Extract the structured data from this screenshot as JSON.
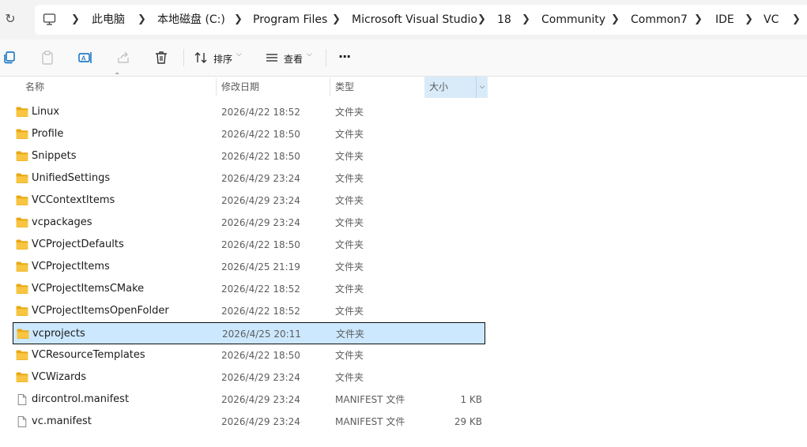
{
  "address_bar": {
    "refresh_icon": "refresh-icon",
    "root_icon": "computer-icon",
    "breadcrumbs": [
      "此电脑",
      "本地磁盘 (C:)",
      "Program Files",
      "Microsoft Visual Studio",
      "18",
      "Community",
      "Common7",
      "IDE",
      "VC"
    ]
  },
  "toolbar": {
    "sort_label": "排序",
    "view_label": "查看",
    "more_label": "···",
    "icons": [
      "copy-icon",
      "paste-icon",
      "rename-icon",
      "share-icon",
      "delete-icon",
      "sort-icon",
      "view-icon",
      "more-icon"
    ]
  },
  "columns": {
    "name": "名称",
    "modified": "修改日期",
    "type": "类型",
    "size": "大小"
  },
  "colors": {
    "folder": "#f8c542",
    "selection": "#cce8ff",
    "header_active": "#d9ebf9"
  },
  "files": [
    {
      "name": "Linux",
      "modified": "2026/4/22 18:52",
      "type": "文件夹",
      "size": "",
      "kind": "folder"
    },
    {
      "name": "Profile",
      "modified": "2026/4/22 18:50",
      "type": "文件夹",
      "size": "",
      "kind": "folder"
    },
    {
      "name": "Snippets",
      "modified": "2026/4/22 18:50",
      "type": "文件夹",
      "size": "",
      "kind": "folder"
    },
    {
      "name": "UnifiedSettings",
      "modified": "2026/4/29 23:24",
      "type": "文件夹",
      "size": "",
      "kind": "folder"
    },
    {
      "name": "VCContextItems",
      "modified": "2026/4/29 23:24",
      "type": "文件夹",
      "size": "",
      "kind": "folder"
    },
    {
      "name": "vcpackages",
      "modified": "2026/4/29 23:24",
      "type": "文件夹",
      "size": "",
      "kind": "folder"
    },
    {
      "name": "VCProjectDefaults",
      "modified": "2026/4/22 18:50",
      "type": "文件夹",
      "size": "",
      "kind": "folder"
    },
    {
      "name": "VCProjectItems",
      "modified": "2026/4/25 21:19",
      "type": "文件夹",
      "size": "",
      "kind": "folder"
    },
    {
      "name": "VCProjectItemsCMake",
      "modified": "2026/4/22 18:52",
      "type": "文件夹",
      "size": "",
      "kind": "folder"
    },
    {
      "name": "VCProjectItemsOpenFolder",
      "modified": "2026/4/22 18:52",
      "type": "文件夹",
      "size": "",
      "kind": "folder"
    },
    {
      "name": "vcprojects",
      "modified": "2026/4/25 20:11",
      "type": "文件夹",
      "size": "",
      "kind": "folder",
      "selected": true
    },
    {
      "name": "VCResourceTemplates",
      "modified": "2026/4/22 18:50",
      "type": "文件夹",
      "size": "",
      "kind": "folder"
    },
    {
      "name": "VCWizards",
      "modified": "2026/4/29 23:24",
      "type": "文件夹",
      "size": "",
      "kind": "folder"
    },
    {
      "name": "dircontrol.manifest",
      "modified": "2026/4/29 23:24",
      "type": "MANIFEST 文件",
      "size": "1 KB",
      "kind": "file"
    },
    {
      "name": "vc.manifest",
      "modified": "2026/4/29 23:24",
      "type": "MANIFEST 文件",
      "size": "29 KB",
      "kind": "file"
    }
  ]
}
